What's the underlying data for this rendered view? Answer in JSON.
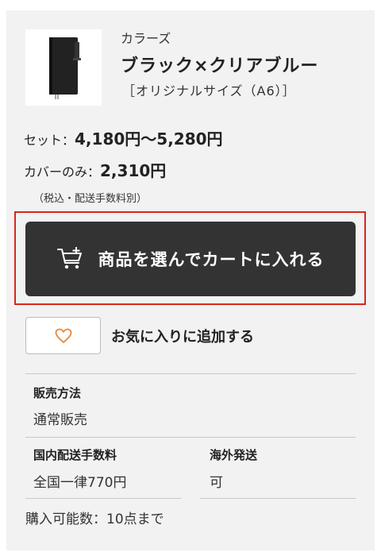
{
  "product": {
    "series": "カラーズ",
    "name": "ブラック×クリアブルー",
    "size": "［オリジナルサイズ（A6）］"
  },
  "prices": {
    "set_label": "セット：",
    "set_value": "4,180円〜5,280円",
    "cover_label": "カバーのみ：",
    "cover_value": "2,310円",
    "tax_note": "（税込・配送手数料別）"
  },
  "cart_button": {
    "label": "商品を選んでカートに入れる",
    "icon": "cart-plus-icon"
  },
  "favorite": {
    "label": "お気に入りに追加する",
    "icon": "heart-icon",
    "icon_color": "#e8863a"
  },
  "info": {
    "sales_method_heading": "販売方法",
    "sales_method_value": "通常販売",
    "domestic_shipping_heading": "国内配送手数料",
    "domestic_shipping_value": "全国一律770円",
    "overseas_shipping_heading": "海外発送",
    "overseas_shipping_value": "可",
    "purchase_limit": "購入可能数：10点まで"
  },
  "colors": {
    "button_bg": "#333333",
    "highlight_border": "#d7261e",
    "panel_bg": "#f2f2f2"
  }
}
